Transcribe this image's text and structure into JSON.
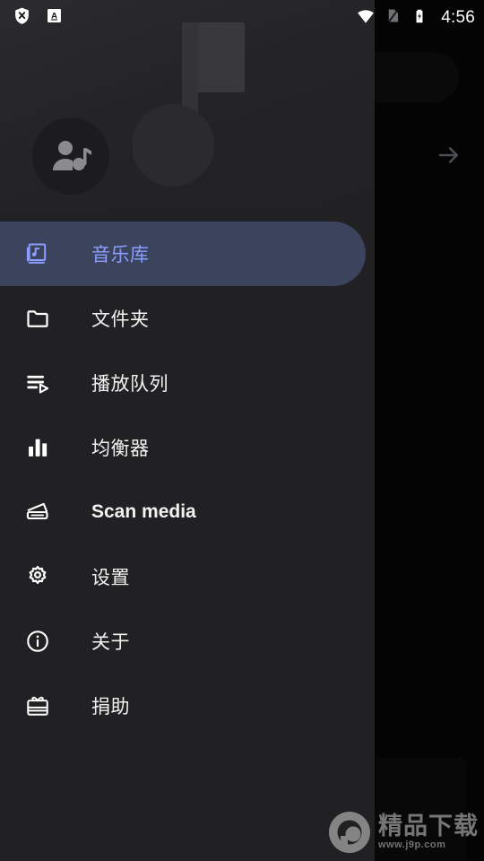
{
  "status_bar": {
    "left_icons": [
      {
        "name": "shield-x-icon",
        "label": "shield"
      },
      {
        "name": "a-badge-icon",
        "label": "A"
      }
    ],
    "right_icons": [
      {
        "name": "wifi-icon",
        "label": "wifi"
      },
      {
        "name": "sim-off-icon",
        "label": "no sim"
      },
      {
        "name": "battery-charging-icon",
        "label": "charging"
      }
    ],
    "time": "4:56"
  },
  "background": {
    "search_placeholder": "",
    "forward_arrow_icon": "arrow-forward-icon"
  },
  "drawer": {
    "header": {
      "avatar_icon": "person-music-icon",
      "watermark_icon": "music-note-icon"
    },
    "items": [
      {
        "label": "音乐库",
        "icon": "library-music-icon",
        "selected": true,
        "bold": false
      },
      {
        "label": "文件夹",
        "icon": "folder-icon",
        "selected": false,
        "bold": false
      },
      {
        "label": "播放队列",
        "icon": "playlist-play-icon",
        "selected": false,
        "bold": false
      },
      {
        "label": "均衡器",
        "icon": "equalizer-icon",
        "selected": false,
        "bold": false
      },
      {
        "label": "Scan media",
        "icon": "scanner-icon",
        "selected": false,
        "bold": true
      },
      {
        "label": "设置",
        "icon": "settings-gear-icon",
        "selected": false,
        "bold": false
      },
      {
        "label": "关于",
        "icon": "info-circle-icon",
        "selected": false,
        "bold": false
      },
      {
        "label": "捐助",
        "icon": "gift-card-icon",
        "selected": false,
        "bold": false
      }
    ]
  },
  "watermark": {
    "title": "精品下载",
    "url": "www.j9p.com",
    "logo_icon": "p-logo-icon"
  },
  "colors": {
    "drawer_bg": "#212123",
    "selected_pill": "#3b445c",
    "accent": "#8c9eff",
    "text": "#f2f2f3",
    "scrim": "rgba(0,0,0,0.60)"
  }
}
